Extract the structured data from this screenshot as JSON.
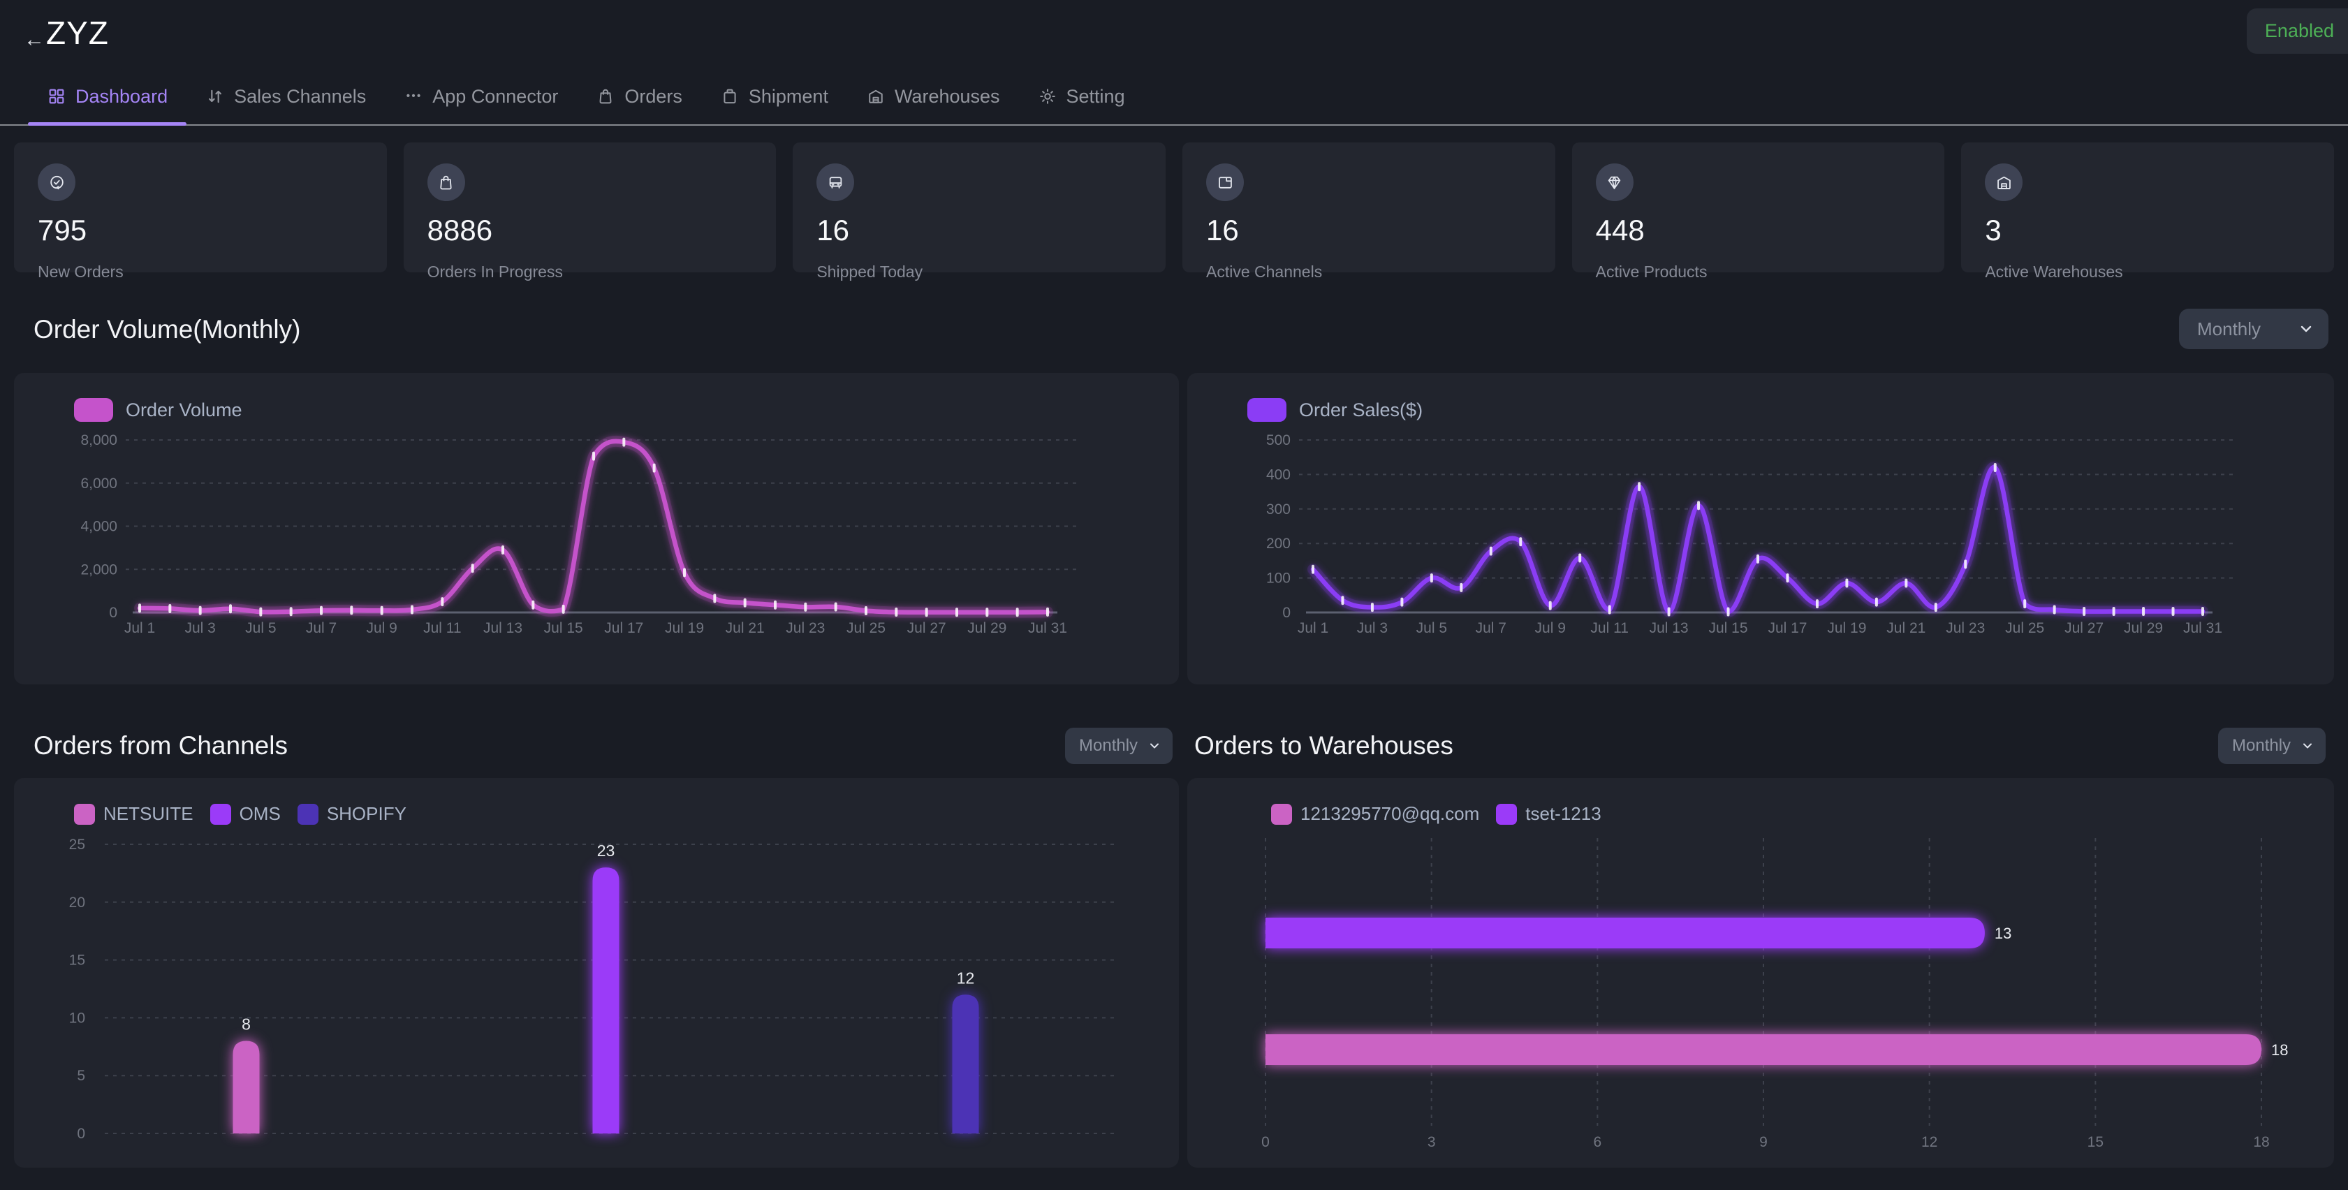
{
  "header": {
    "title": "ZYZ",
    "back_icon": "left-arrow",
    "badge": "Enabled",
    "badge_color": "#4db056"
  },
  "nav": {
    "active_color": "#a585f6",
    "tabs": [
      {
        "label": "Dashboard",
        "icon": "dashboard-grid-icon",
        "active": true
      },
      {
        "label": "Sales Channels",
        "icon": "swap-vertical-icon",
        "active": false
      },
      {
        "label": "App Connector",
        "icon": "ellipsis-icon",
        "active": false
      },
      {
        "label": "Orders",
        "icon": "shopping-bag-icon",
        "active": false
      },
      {
        "label": "Shipment",
        "icon": "package-bag-icon",
        "active": false
      },
      {
        "label": "Warehouses",
        "icon": "warehouse-icon",
        "active": false
      },
      {
        "label": "Setting",
        "icon": "gear-icon",
        "active": false
      }
    ]
  },
  "stats": [
    {
      "value": "795",
      "label": "New Orders",
      "icon": "order-check-icon"
    },
    {
      "value": "8886",
      "label": "Orders In Progress",
      "icon": "shopping-bag-icon"
    },
    {
      "value": "16",
      "label": "Shipped Today",
      "icon": "truck-icon"
    },
    {
      "value": "16",
      "label": "Active Channels",
      "icon": "browser-window-icon"
    },
    {
      "value": "448",
      "label": "Active Products",
      "icon": "gem-icon"
    },
    {
      "value": "3",
      "label": "Active Warehouses",
      "icon": "warehouse-icon"
    }
  ],
  "sections": {
    "order_volume": {
      "title": "Order Volume(Monthly)",
      "period_selector": "Monthly"
    },
    "orders_from_channels": {
      "title": "Orders from Channels",
      "period_selector": "Monthly"
    },
    "orders_to_warehouses": {
      "title": "Orders to Warehouses",
      "period_selector": "Monthly"
    }
  },
  "colors": {
    "page_bg": "#191c24",
    "panel_bg": "#21242d",
    "card_bg": "#23262f",
    "accent_purple": "#a585f6",
    "badge_green": "#4db056",
    "line_pink": "#c553cb",
    "line_violet": "#8b3df5",
    "bar_pink": "#cb63c4",
    "bar_purple": "#9b3bf8",
    "bar_indigo": "#4c33b5"
  },
  "chart_data": [
    {
      "id": "order-volume",
      "type": "line",
      "color": "#c553cb",
      "legend": [
        {
          "label": "Order Volume",
          "color": "#c553cb"
        }
      ],
      "x": [
        "Jul 1",
        "Jul 2",
        "Jul 3",
        "Jul 4",
        "Jul 5",
        "Jul 6",
        "Jul 7",
        "Jul 8",
        "Jul 9",
        "Jul 10",
        "Jul 11",
        "Jul 12",
        "Jul 13",
        "Jul 14",
        "Jul 15",
        "Jul 16",
        "Jul 17",
        "Jul 18",
        "Jul 19",
        "Jul 20",
        "Jul 21",
        "Jul 22",
        "Jul 23",
        "Jul 24",
        "Jul 25",
        "Jul 26",
        "Jul 27",
        "Jul 28",
        "Jul 29",
        "Jul 30",
        "Jul 31"
      ],
      "values": [
        200,
        180,
        90,
        170,
        30,
        40,
        90,
        100,
        90,
        130,
        500,
        2050,
        2900,
        350,
        150,
        7250,
        7900,
        6700,
        1850,
        650,
        450,
        350,
        250,
        260,
        80,
        15,
        10,
        10,
        10,
        10,
        20
      ],
      "ylim": [
        0,
        8000
      ],
      "y_ticks": [
        0,
        2000,
        4000,
        6000,
        8000
      ],
      "y_tick_labels": [
        "0",
        "2,000",
        "4,000",
        "6,000",
        "8,000"
      ],
      "x_label_every": 2,
      "grid": "dashed",
      "legend_position": "top-left"
    },
    {
      "id": "order-sales",
      "type": "line",
      "color": "#8b3df5",
      "legend": [
        {
          "label": "Order Sales($)",
          "color": "#8b3df5"
        }
      ],
      "x": [
        "Jul 1",
        "Jul 2",
        "Jul 3",
        "Jul 4",
        "Jul 5",
        "Jul 6",
        "Jul 7",
        "Jul 8",
        "Jul 9",
        "Jul 10",
        "Jul 11",
        "Jul 12",
        "Jul 13",
        "Jul 14",
        "Jul 15",
        "Jul 16",
        "Jul 17",
        "Jul 18",
        "Jul 19",
        "Jul 20",
        "Jul 21",
        "Jul 22",
        "Jul 23",
        "Jul 24",
        "Jul 25",
        "Jul 26",
        "Jul 27",
        "Jul 28",
        "Jul 29",
        "Jul 30",
        "Jul 31"
      ],
      "values": [
        125,
        35,
        15,
        30,
        100,
        72,
        178,
        205,
        20,
        158,
        8,
        365,
        2,
        310,
        2,
        155,
        100,
        25,
        85,
        30,
        85,
        15,
        140,
        420,
        25,
        8,
        3,
        3,
        3,
        3,
        3
      ],
      "ylim": [
        0,
        500
      ],
      "y_ticks": [
        0,
        100,
        200,
        300,
        400,
        500
      ],
      "y_tick_labels": [
        "0",
        "100",
        "200",
        "300",
        "400",
        "500"
      ],
      "x_label_every": 2,
      "grid": "dashed",
      "legend_position": "top-left"
    },
    {
      "id": "orders-from-channels",
      "type": "bar",
      "categories": [
        "NETSUITE",
        "OMS",
        "SHOPIFY"
      ],
      "values": [
        8,
        23,
        12
      ],
      "colors": [
        "#cb63c4",
        "#9b3bf8",
        "#4c33b5"
      ],
      "value_labels": [
        "8",
        "23",
        "12"
      ],
      "ylim": [
        0,
        25
      ],
      "y_ticks": [
        0,
        5,
        10,
        15,
        20,
        25
      ],
      "y_tick_labels": [
        "0",
        "5",
        "10",
        "15",
        "20",
        "25"
      ],
      "legend": [
        {
          "label": "NETSUITE",
          "color": "#cb63c4"
        },
        {
          "label": "OMS",
          "color": "#9b3bf8"
        },
        {
          "label": "SHOPIFY",
          "color": "#4c33b5"
        }
      ],
      "grid": "dashed",
      "legend_position": "top-left"
    },
    {
      "id": "orders-to-warehouses",
      "type": "hbar",
      "rows": [
        {
          "label": "tset-1213",
          "value": 13,
          "value_label": "13",
          "color": "#9b3bf8"
        },
        {
          "label": "1213295770@qq.com",
          "value": 18,
          "value_label": "18",
          "color": "#cb63c4"
        }
      ],
      "xlim": [
        0,
        18
      ],
      "x_ticks": [
        0,
        3,
        6,
        9,
        12,
        15,
        18
      ],
      "x_tick_labels": [
        "0",
        "3",
        "6",
        "9",
        "12",
        "15",
        "18"
      ],
      "legend": [
        {
          "label": "1213295770@qq.com",
          "color": "#cb63c4"
        },
        {
          "label": "tset-1213",
          "color": "#9b3bf8"
        }
      ],
      "grid": "dashed-vertical",
      "legend_position": "top-left"
    }
  ]
}
